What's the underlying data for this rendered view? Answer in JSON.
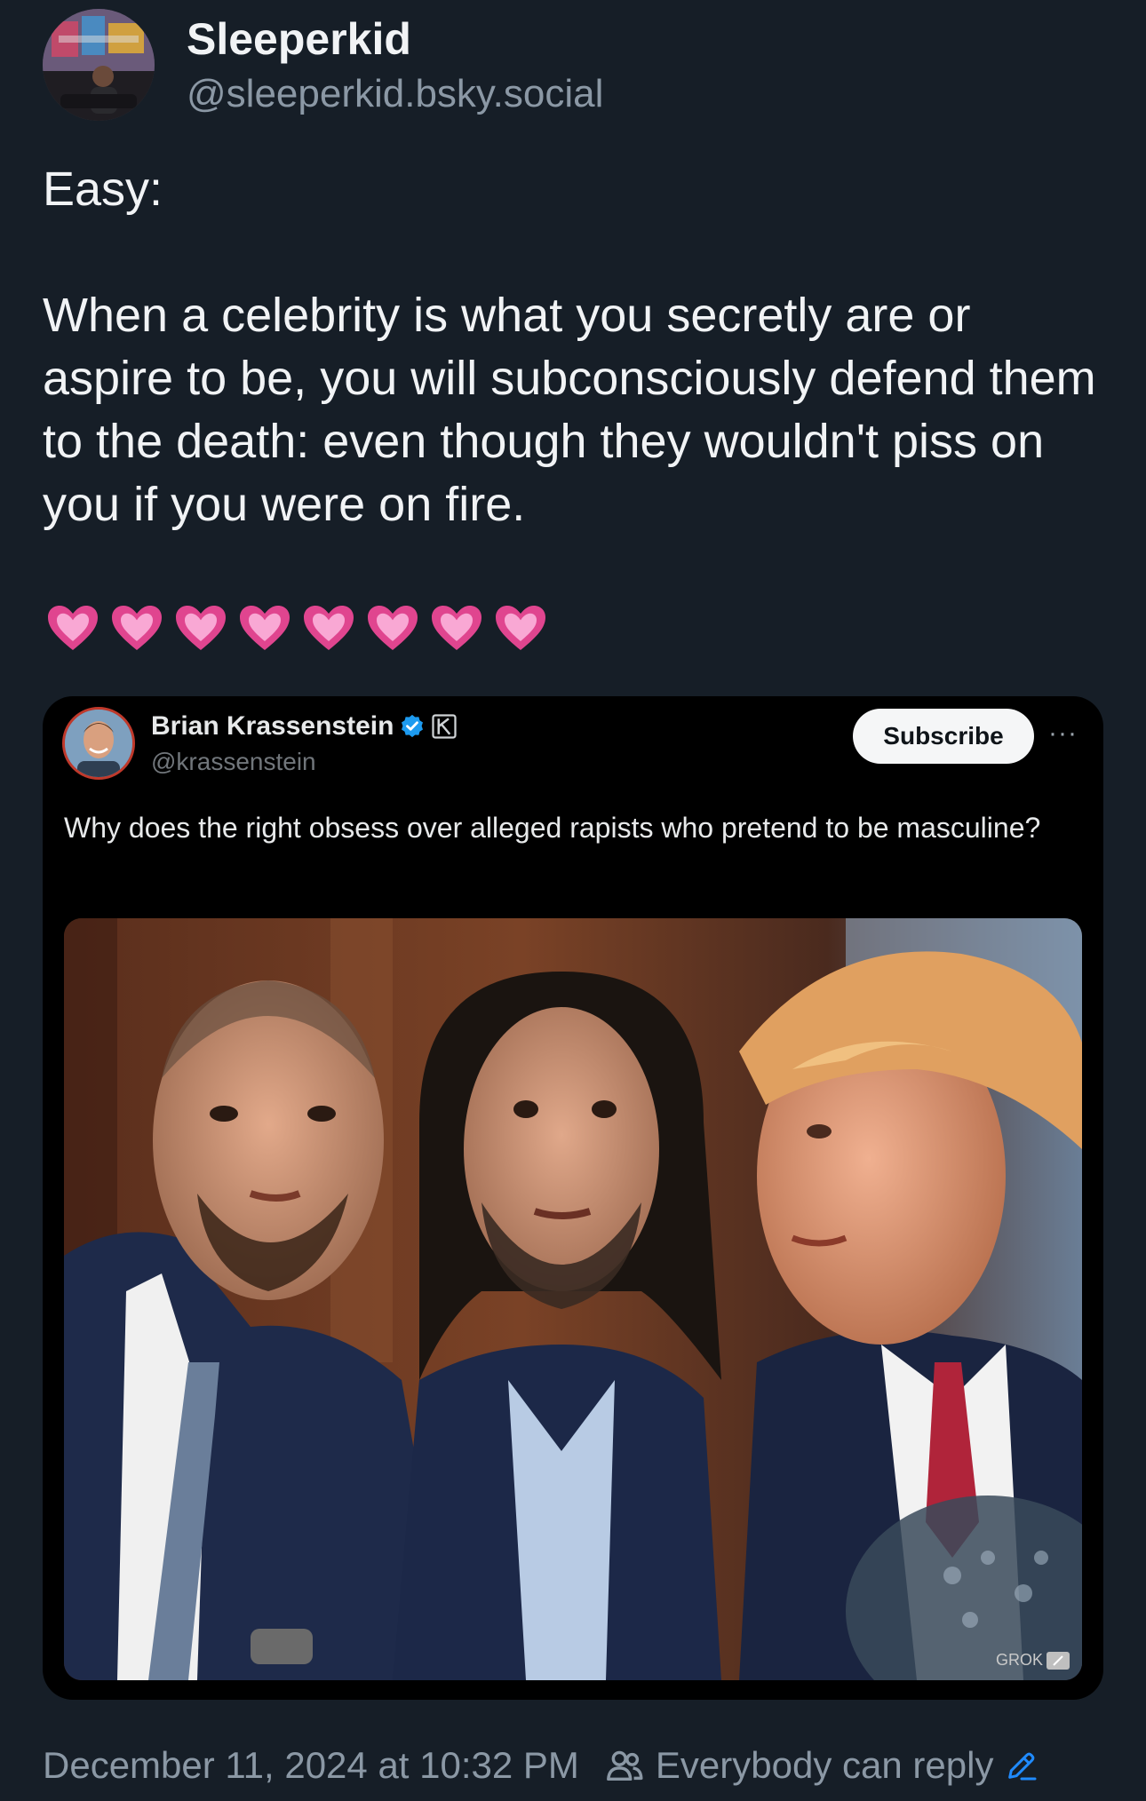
{
  "author": {
    "display_name": "Sleeperkid",
    "handle": "@sleeperkid.bsky.social",
    "avatar_icon": "user-avatar-photo"
  },
  "post": {
    "lines": [
      "Easy:",
      "When a celebrity is what you secretly are or aspire to be, you will subconsciously defend them to the death: even though they wouldn't piss on you if you were on fire."
    ],
    "emoji": [
      "💗",
      "💗",
      "💗",
      "💗",
      "💗",
      "💗",
      "💗",
      "💗"
    ]
  },
  "embed": {
    "name": "Brian Krassenstein",
    "verified_icon": "verified-badge-icon",
    "affiliation_icon": "k-affiliation-icon",
    "handle": "@krassenstein",
    "subscribe_label": "Subscribe",
    "more_label": "···",
    "text": "Why does the right obsess over alleged rapists who pretend to be masculine?",
    "watermark": "GROK"
  },
  "footer": {
    "timestamp": "December 11, 2024 at 10:32 PM",
    "reply_setting": "Everybody can reply",
    "people_icon": "people-icon",
    "edit_icon": "edit-pencil-icon"
  },
  "colors": {
    "background": "#161e27",
    "accent": "#208bfe",
    "muted": "#8b98a5"
  }
}
